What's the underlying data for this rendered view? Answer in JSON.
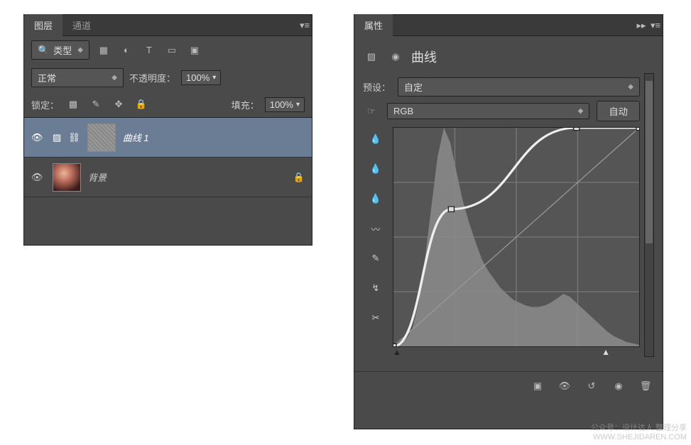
{
  "layers_panel": {
    "tabs": {
      "layers": "图层",
      "channels": "通道"
    },
    "filter_label": "类型",
    "blend_mode": "正常",
    "opacity_label": "不透明度：",
    "opacity_value": "100%",
    "lock_label": "锁定：",
    "fill_label": "填充：",
    "fill_value": "100%",
    "layers": [
      {
        "name": "曲线 1",
        "type": "adjustment",
        "selected": true
      },
      {
        "name": "背景",
        "type": "image",
        "selected": false,
        "locked": true
      }
    ]
  },
  "props_panel": {
    "tab": "属性",
    "title": "曲线",
    "preset_label": "预设：",
    "preset_value": "自定",
    "channel_value": "RGB",
    "auto_label": "自动"
  },
  "chart_data": {
    "type": "line",
    "title": "曲线",
    "xlabel": "",
    "ylabel": "",
    "xlim": [
      0,
      255
    ],
    "ylim": [
      0,
      255
    ],
    "grid": true,
    "series": [
      {
        "name": "curve",
        "x": [
          0,
          60,
          190,
          255
        ],
        "y": [
          0,
          160,
          255,
          255
        ]
      },
      {
        "name": "baseline",
        "x": [
          0,
          255
        ],
        "y": [
          0,
          255
        ]
      }
    ],
    "histogram_approx": [
      0,
      2,
      5,
      12,
      30,
      60,
      95,
      130,
      150,
      140,
      120,
      100,
      85,
      72,
      60,
      52,
      46,
      40,
      36,
      32,
      30,
      28,
      27,
      27,
      28,
      30,
      33,
      36,
      34,
      30,
      26,
      22,
      18,
      14,
      10,
      7,
      5,
      3,
      2,
      1
    ]
  },
  "watermark": {
    "line1": "公众号：设计达人 整理分享",
    "line2": "WWW.SHEJIDAREN.COM"
  }
}
